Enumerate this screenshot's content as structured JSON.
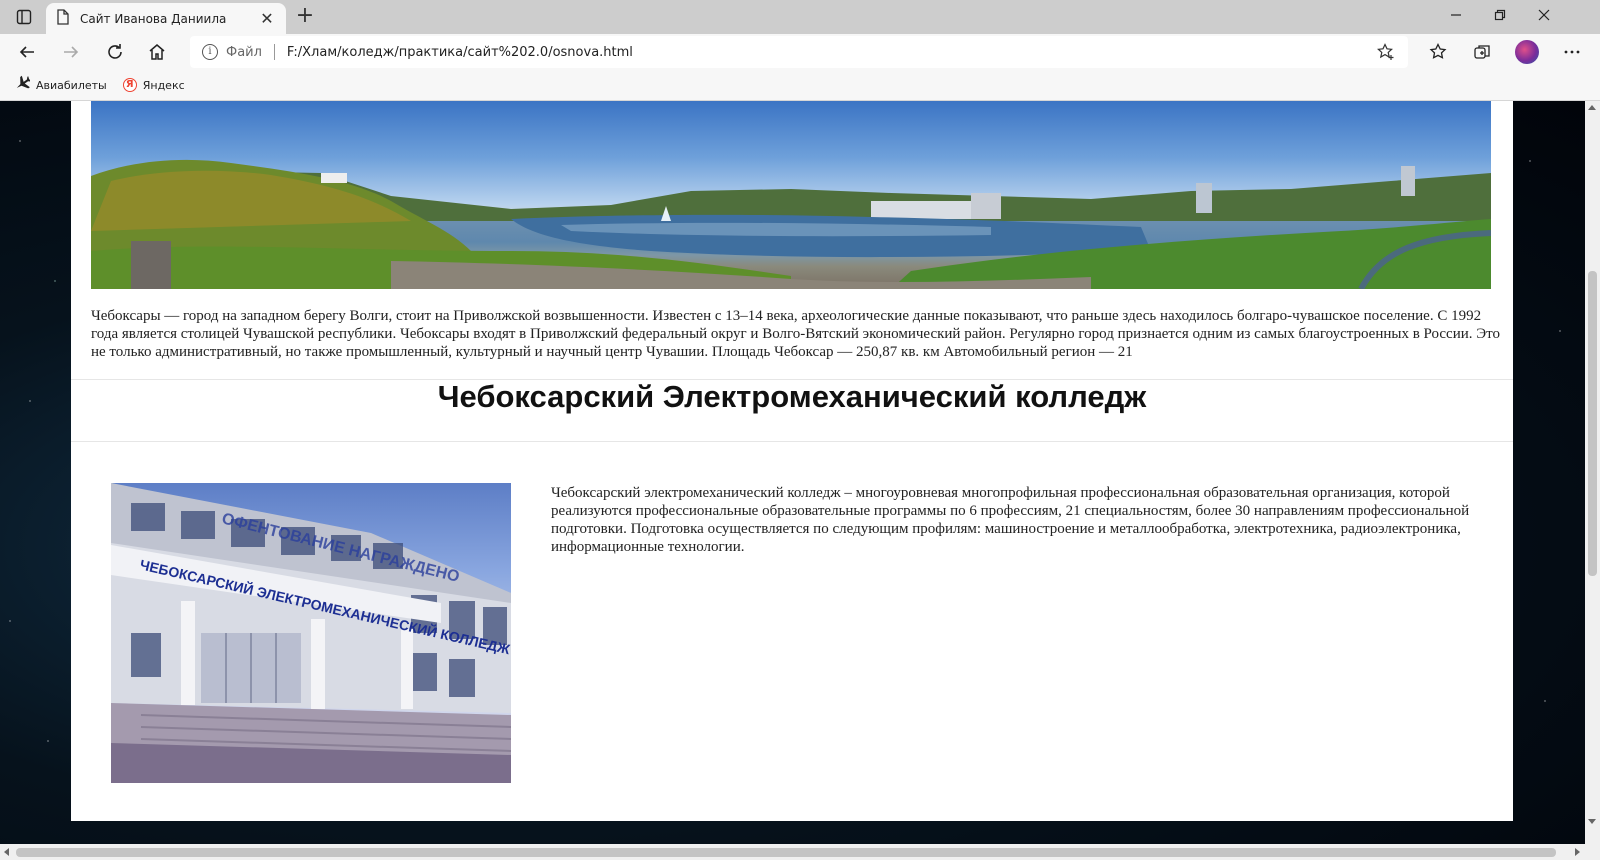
{
  "browser": {
    "tab": {
      "title": "Сайт Иванова Даниила"
    },
    "address": {
      "scheme_label": "Файл",
      "url": "F:/Хлам/коледж/практика/сайт%202.0/osnova.html"
    },
    "bookmarks": [
      {
        "label": "Авиабилеты",
        "icon": "plane-icon"
      },
      {
        "label": "Яндекс",
        "icon": "yandex-icon"
      }
    ]
  },
  "page": {
    "intro_text": "Чебоксары — город на западном берегу Волги, стоит на Приволжской возвышенности. Известен с 13–14 века, археологические данные показывают, что раньше здесь находилось болгаро-чувашское поселение. С 1992 года является столицей Чувашской республики. Чебоксары входят в Приволжский федеральный округ и Волго-Вятский экономический район. Регулярно город признается одним из самых благоустроенных в России. Это не только административный, но также промышленный, культурный и научный центр Чувашии. Площадь Чебоксар — 250,87 кв. км Автомобильный регион — 21",
    "heading": "Чебоксарский Электромеханический колледж",
    "college_text": "Чебоксарский электромеханический колледж – многоуровневая многопрофильная профессиональная образовательная организация, которой реализуются профессиональные образовательные программы по 6 профессиям, 21 специальностям, более 30 направлениям профессиональной подготовки. Подготовка осуществляется по следующим профилям: машиностроение и металлообработка, электротехника, радиоэлектроника, информационные технологии.",
    "photo_sign_line1": "ЧЕБОКСАРСКИЙ ЭЛЕКТРОМЕХАНИЧЕСКИЙ КОЛЛЕДЖ",
    "photo_sign_line2": "ОФЕНТОВАНИЕ НАГРАЖДЕНО"
  },
  "colors": {
    "chrome_bg": "#f7f7f7",
    "tabbar_bg": "#cdcdcd",
    "page_bg": "#ffffff",
    "space_bg": "#06121c"
  }
}
